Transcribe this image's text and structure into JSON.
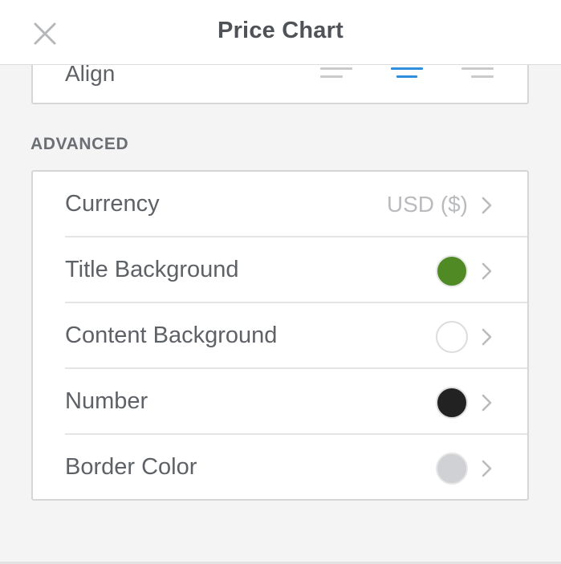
{
  "header": {
    "title": "Price Chart",
    "close_icon": "close-icon"
  },
  "align": {
    "label": "Align",
    "options": [
      "align-left-icon",
      "align-center-icon",
      "align-right-icon"
    ],
    "selected": "center",
    "active_color": "#2f8fde",
    "inactive_color": "#c8c8c8"
  },
  "advanced": {
    "heading": "ADVANCED",
    "rows": [
      {
        "label": "Currency",
        "value": "USD ($)"
      },
      {
        "label": "Title Background",
        "swatch": "#4f8a25"
      },
      {
        "label": "Content Background",
        "swatch": "#ffffff"
      },
      {
        "label": "Number",
        "swatch": "#222222"
      },
      {
        "label": "Border Color",
        "swatch": "#cfd1d4"
      }
    ]
  }
}
